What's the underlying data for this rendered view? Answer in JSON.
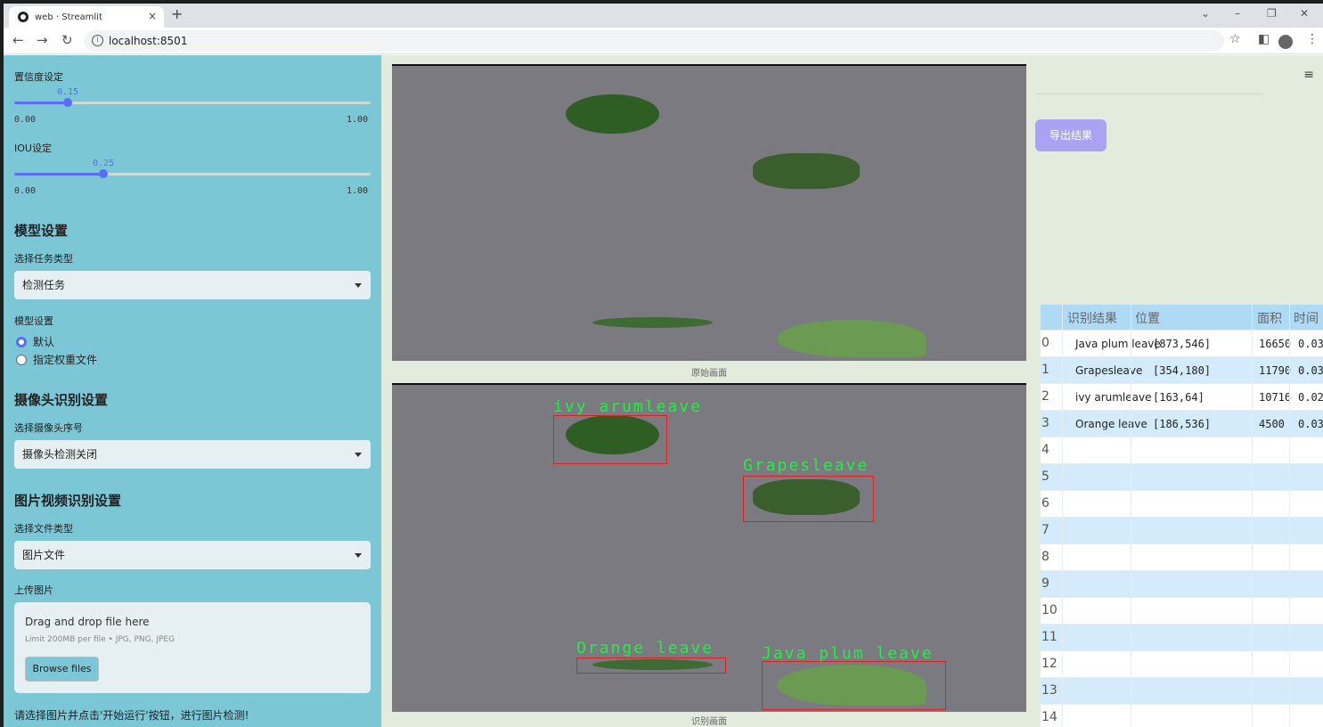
{
  "browser": {
    "tab_title": "web · Streamlit",
    "tab_close": "×",
    "new_tab": "+",
    "url": "localhost:8501",
    "window_controls": [
      "⌄",
      "–",
      "❐",
      "✕"
    ]
  },
  "sidebar": {
    "confidence": {
      "label": "置信度设定",
      "value": "0.15",
      "min": "0.00",
      "max": "1.00",
      "level": 0.15
    },
    "iou": {
      "label": "IOU设定",
      "value": "0.25",
      "min": "0.00",
      "max": "1.00",
      "level": 0.25
    },
    "model_heading": "模型设置",
    "task_label": "选择任务类型",
    "task_value": "检测任务",
    "model_label": "模型设置",
    "model_options": [
      "默认",
      "指定权重文件"
    ],
    "model_selected": 0,
    "camera_heading": "摄像头识别设置",
    "camera_label": "选择摄像头序号",
    "camera_value": "摄像头检测关闭",
    "media_heading": "图片视频识别设置",
    "filetype_label": "选择文件类型",
    "filetype_value": "图片文件",
    "upload_label": "上传图片",
    "upload": {
      "drop_text": "Drag and drop file here",
      "limit_text": "Limit 200MB per file • JPG, PNG, JPEG",
      "button": "Browse files"
    },
    "hint": "请选择图片并点击'开始运行'按钮，进行图片检测!"
  },
  "main": {
    "original_caption": "原始画面",
    "result_caption": "识别画面",
    "detections": [
      "ivy arumleave",
      "Grapesleave",
      "Orange leave",
      "Java plum leave"
    ],
    "export_button": "导出结果",
    "menu_icon": "≡"
  },
  "table": {
    "headers": [
      "识别结果",
      "位置",
      "面积",
      "时间"
    ],
    "rows": [
      {
        "idx": "0",
        "name": "Java plum leave",
        "pos": "[873,546]",
        "area": "16650",
        "time": "0.03"
      },
      {
        "idx": "1",
        "name": "Grapesleave",
        "pos": "[354,180]",
        "area": "11790",
        "time": "0.03"
      },
      {
        "idx": "2",
        "name": "ivy arumleave",
        "pos": "[163,64]",
        "area": "10716",
        "time": "0.02"
      },
      {
        "idx": "3",
        "name": "Orange leave",
        "pos": "[186,536]",
        "area": "4500",
        "time": "0.03"
      },
      {
        "idx": "4",
        "name": "",
        "pos": "",
        "area": "",
        "time": ""
      },
      {
        "idx": "5",
        "name": "",
        "pos": "",
        "area": "",
        "time": ""
      },
      {
        "idx": "6",
        "name": "",
        "pos": "",
        "area": "",
        "time": ""
      },
      {
        "idx": "7",
        "name": "",
        "pos": "",
        "area": "",
        "time": ""
      },
      {
        "idx": "8",
        "name": "",
        "pos": "",
        "area": "",
        "time": ""
      },
      {
        "idx": "9",
        "name": "",
        "pos": "",
        "area": "",
        "time": ""
      },
      {
        "idx": "10",
        "name": "",
        "pos": "",
        "area": "",
        "time": ""
      },
      {
        "idx": "11",
        "name": "",
        "pos": "",
        "area": "",
        "time": ""
      },
      {
        "idx": "12",
        "name": "",
        "pos": "",
        "area": "",
        "time": ""
      },
      {
        "idx": "13",
        "name": "",
        "pos": "",
        "area": "",
        "time": ""
      },
      {
        "idx": "14",
        "name": "",
        "pos": "",
        "area": "",
        "time": ""
      }
    ],
    "row_colors": [
      "#ffffff",
      "#d4ebfb"
    ]
  }
}
